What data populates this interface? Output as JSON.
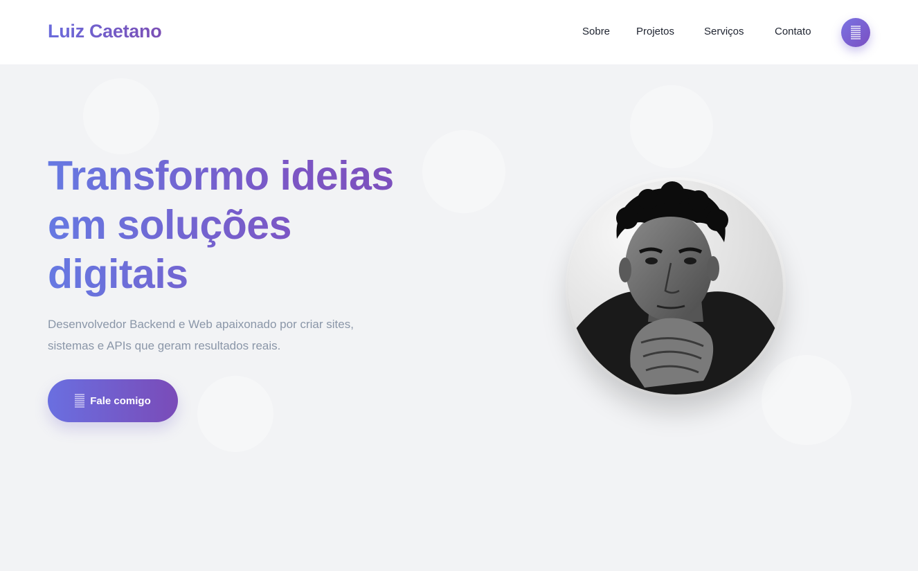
{
  "header": {
    "brand": "Luiz Caetano",
    "nav": [
      {
        "label": "Sobre"
      },
      {
        "label": "Projetos"
      },
      {
        "label": "Serviços"
      },
      {
        "label": "Contato"
      }
    ],
    "menu_icon": "menu-lines-icon"
  },
  "hero": {
    "title_lines": [
      "Transformo ideias",
      "em soluções",
      "digitais"
    ],
    "description_lines": [
      "Desenvolvedor Backend e Web apaixonado por criar sites,",
      "sistemas e APIs que geram resultados reais."
    ],
    "cta_label": "Fale comigo",
    "cta_icon": "lines-icon",
    "portrait": "profile-photo"
  },
  "colors": {
    "accent_start": "#6a6fe0",
    "accent_end": "#7a4bb8",
    "hero_bg": "#f2f3f5",
    "text_muted": "#8a96a8",
    "nav_text": "#1f2430"
  }
}
